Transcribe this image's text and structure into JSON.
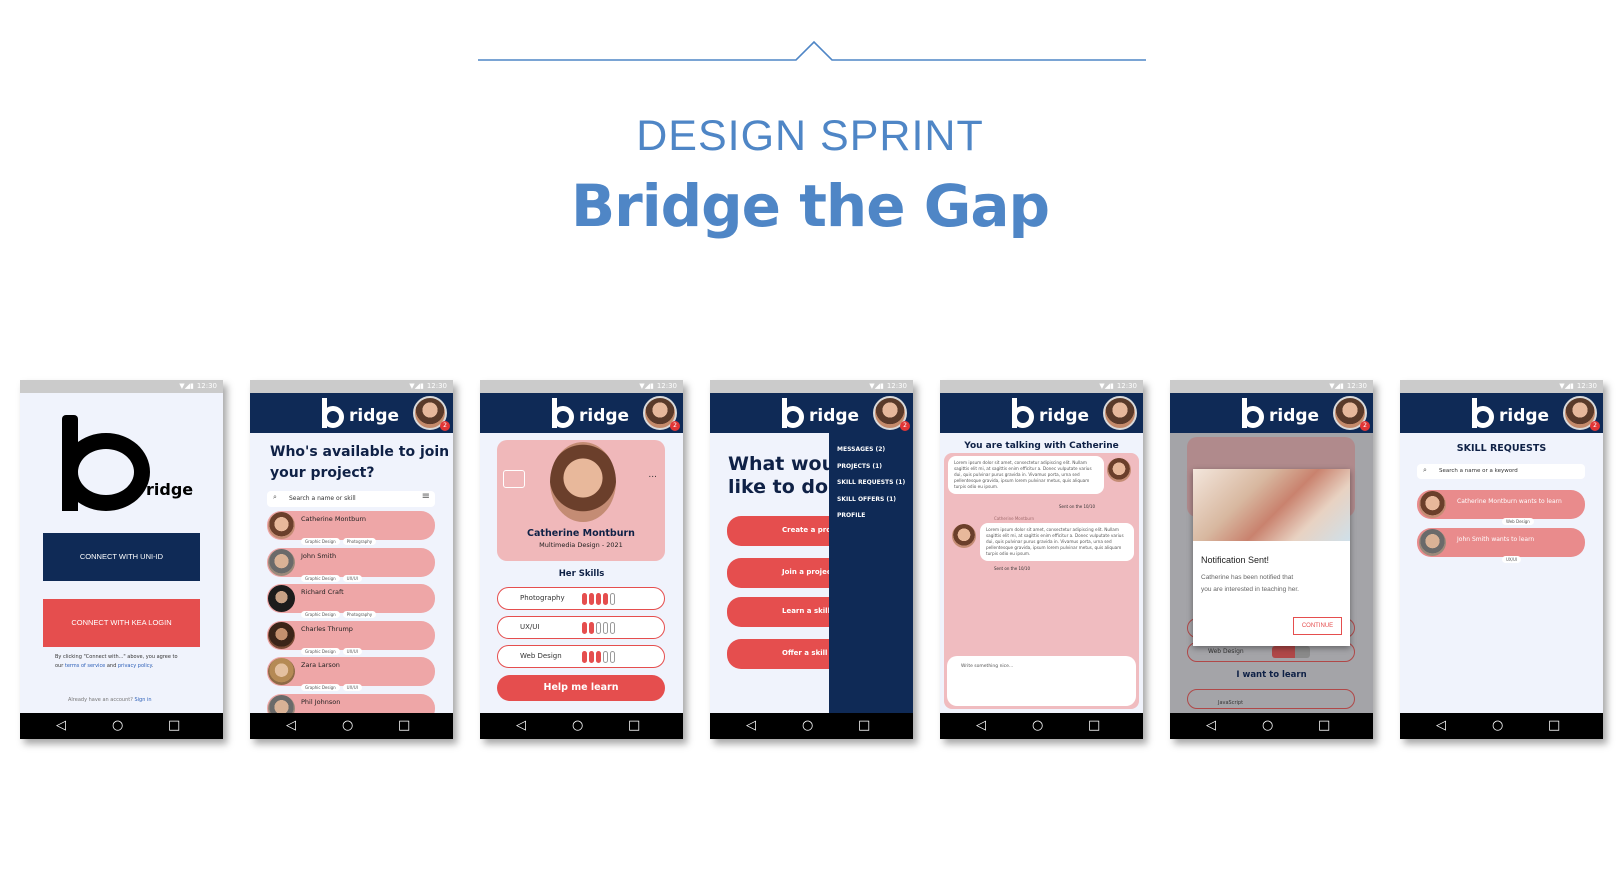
{
  "header": {
    "label": "DESIGN SPRINT",
    "title": "Bridge the Gap"
  },
  "status_time": "12:30",
  "app": {
    "logo_word": "ridge"
  },
  "screens": {
    "login": {
      "logo_word": "ridge",
      "uni_button": "CONNECT WITH UNI-ID",
      "kea_button": "CONNECT WITH KEA LOGIN",
      "terms_text_1": "By clicking \"Connect with...\" above, you agree to",
      "terms_text_2a": "our ",
      "terms_link": "terms of service",
      "terms_and": " and ",
      "privacy_link": "privacy policy",
      "terms_end": ".",
      "already": "Already have an account?",
      "sign_in": "Sign in"
    },
    "search": {
      "heading_line1": "Who's available to join",
      "heading_line2": "your project?",
      "search_placeholder": "Search a name or skill",
      "people": [
        {
          "name": "Catherine Montburn",
          "tags": [
            "Graphic Design",
            "Photography"
          ]
        },
        {
          "name": "John Smith",
          "tags": [
            "Graphic Design",
            "UX/UI"
          ]
        },
        {
          "name": "Richard Craft",
          "tags": [
            "Graphic Design",
            "Photography"
          ]
        },
        {
          "name": "Charles Thrump",
          "tags": [
            "Graphic Design",
            "UX/UI"
          ]
        },
        {
          "name": "Zara Larson",
          "tags": [
            "Graphic Design",
            "UX/UI"
          ]
        },
        {
          "name": "Phil Johnson",
          "tags": []
        }
      ]
    },
    "profile": {
      "name": "Catherine Montburn",
      "subtitle": "Multimedia Design - 2021",
      "more": "...",
      "skills_heading": "Her Skills",
      "skills": [
        {
          "label": "Photography",
          "level": 4
        },
        {
          "label": "UX/UI",
          "level": 2
        },
        {
          "label": "Web Design",
          "level": 3
        }
      ],
      "cta": "Help me learn"
    },
    "menu": {
      "heading_line1": "What would you",
      "heading_line2": "like to do ?",
      "actions": [
        "Create a project",
        "Join a project",
        "Learn a skill",
        "Offer a skill"
      ],
      "drawer_items": [
        "MESSAGES (2)",
        "PROJECTS (1)",
        "SKILL REQUESTS (1)",
        "SKILL OFFERS (1)",
        "PROFILE"
      ]
    },
    "chat": {
      "heading": "You are talking with Catherine",
      "msg1": "Lorem ipsum dolor sit amet, consectetur adipiscing elit. Nullam sagittis elit mi, at sagittis enim efficitur a. Donec vulputate varius dui, quis pulvinar purus gravida in. Vivamus porta, urna sed pellentesque gravida, ipsum lorem pulvinar metus, quis aliquam turpis odio eu ipsum.",
      "time1": "Sent on the 10/10",
      "sender2": "Catherine Montburn",
      "msg2": "Lorem ipsum dolor sit amet, consectetur adipiscing elit. Nullam sagittis elit mi, at sagittis enim efficitur a. Donec vulputate varius dui, quis pulvinar purus gravida in. Vivamus porta, urna sed pellentesque gravida, ipsum lorem pulvinar metus, quis aliquam turpis odio eu ipsum.",
      "time2": "Sent on the 10/10",
      "input_placeholder": "Write something nice..."
    },
    "notification": {
      "title": "Notification Sent!",
      "body_line1": "Catherine has been notified that",
      "body_line2": "you are interested in teaching her.",
      "continue": "CONTINUE",
      "bg_skill": "Web Design",
      "bg_heading": "I want to learn",
      "bg_skill2": "JavaScript"
    },
    "requests": {
      "heading": "SKILL REQUESTS",
      "search_placeholder": "Search a name or a keyword",
      "items": [
        {
          "text": "Catherine Montburn wants to learn",
          "tag": "Web Design"
        },
        {
          "text": "John Smith wants to learn",
          "tag": "UX/UI"
        }
      ]
    }
  },
  "icons": {
    "back": "◁",
    "home": "○",
    "recent": "□",
    "search": "🔍",
    "chat": "chat-bubble-icon",
    "filter": "≡"
  },
  "colors": {
    "navy": "#0f2a56",
    "red": "#e54e4e",
    "pink": "#eea6a7",
    "title_blue": "#4f86c6"
  }
}
